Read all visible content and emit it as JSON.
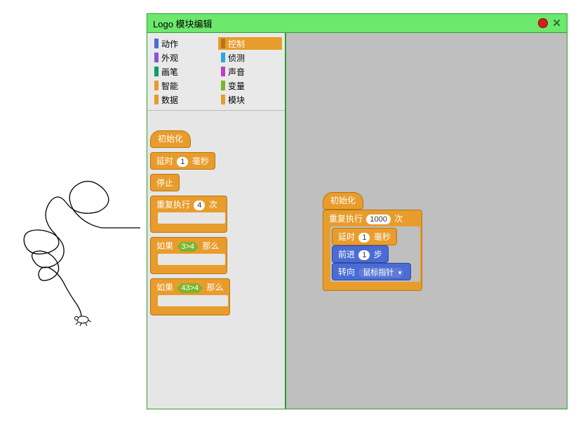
{
  "window": {
    "title": "Logo 模块编辑"
  },
  "palette": {
    "col1": [
      {
        "label": "动作",
        "color": "#4a6cd4"
      },
      {
        "label": "外观",
        "color": "#8a55d7"
      },
      {
        "label": "画笔",
        "color": "#0e9a6c"
      },
      {
        "label": "智能",
        "color": "#e89c2c"
      },
      {
        "label": "数据",
        "color": "#e89c2c"
      }
    ],
    "col2": [
      {
        "label": "控制",
        "color": "#e89c2c",
        "selected": true
      },
      {
        "label": "侦测",
        "color": "#2ca5e2"
      },
      {
        "label": "声音",
        "color": "#bb42c3"
      },
      {
        "label": "变量",
        "color": "#7ab52c"
      },
      {
        "label": "模块",
        "color": "#e89c2c"
      }
    ]
  },
  "blocks": {
    "init": "初始化",
    "delay_prefix": "延时",
    "delay_val": "1",
    "delay_suffix": "毫秒",
    "stop": "停止",
    "repeat_prefix": "重复执行",
    "repeat_val": "4",
    "repeat_suffix": "次",
    "if_prefix": "如果",
    "if_cond1": "3>4",
    "if_cond2": "43>4",
    "if_suffix": "那么"
  },
  "script": {
    "hat": "初始化",
    "repeat_prefix": "重复执行",
    "repeat_val": "1000",
    "repeat_suffix": "次",
    "delay_prefix": "延时",
    "delay_val": "1",
    "delay_suffix": "毫秒",
    "forward_prefix": "前进",
    "forward_val": "1",
    "forward_suffix": "步",
    "turn_prefix": "转向",
    "turn_target": "鼠标指针"
  }
}
